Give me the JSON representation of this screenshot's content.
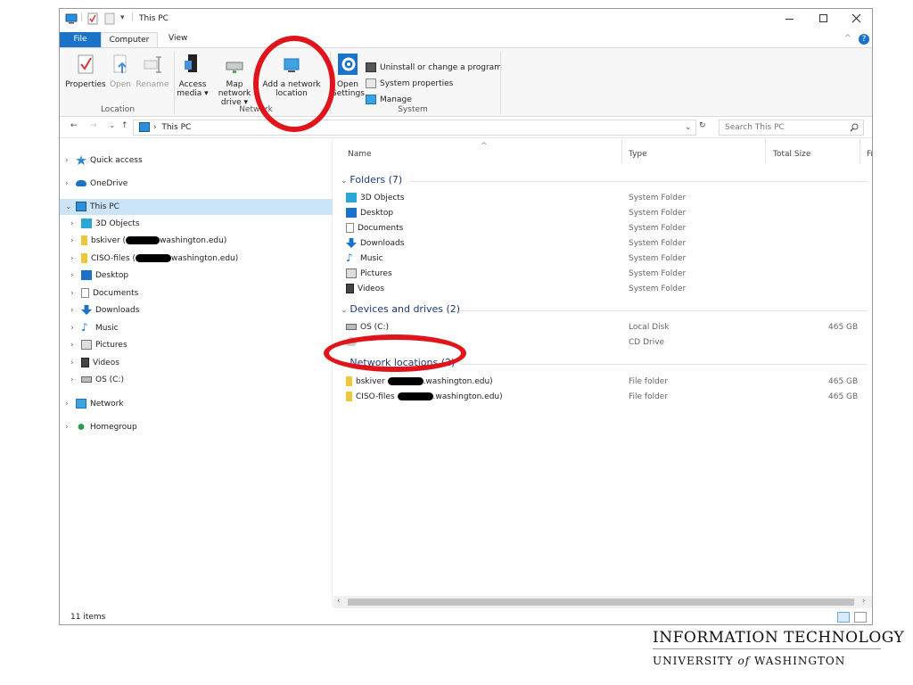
{
  "window": {
    "title": "This PC"
  },
  "ribbon": {
    "tabs": {
      "file": "File",
      "computer": "Computer",
      "view": "View"
    },
    "location": {
      "label": "Location",
      "properties": "Properties",
      "open": "Open",
      "rename": "Rename"
    },
    "network": {
      "label": "Network",
      "access_media_1": "Access",
      "access_media_2": "media ▾",
      "map_drive_1": "Map network",
      "map_drive_2": "drive ▾",
      "add_location_1": "Add a network",
      "add_location_2": "location"
    },
    "system": {
      "label": "System",
      "open_settings_1": "Open",
      "open_settings_2": "Settings",
      "uninstall": "Uninstall or change a program",
      "system_properties": "System properties",
      "manage": "Manage"
    }
  },
  "address": {
    "path": "This PC",
    "search_placeholder": "Search This PC"
  },
  "navpane": {
    "quick_access": "Quick access",
    "onedrive": "OneDrive",
    "this_pc": "This PC",
    "objects3d": "3D Objects",
    "bskiver_prefix": "bskiver (",
    "bskiver_suffix": "washington.edu)",
    "ciso_prefix": "CISO-files (",
    "ciso_suffix": "washington.edu)",
    "desktop": "Desktop",
    "documents": "Documents",
    "downloads": "Downloads",
    "music": "Music",
    "pictures": "Pictures",
    "videos": "Videos",
    "osc": "OS (C:)",
    "network": "Network",
    "homegroup": "Homegroup"
  },
  "columns": {
    "name": "Name",
    "type": "Type",
    "total_size": "Total Size",
    "free": "Fr"
  },
  "groups": {
    "folders": "Folders (7)",
    "devices": "Devices and drives (2)",
    "network": "Network locations (2)"
  },
  "folders": [
    {
      "name": "3D Objects",
      "type": "System Folder"
    },
    {
      "name": "Desktop",
      "type": "System Folder"
    },
    {
      "name": "Documents",
      "type": "System Folder"
    },
    {
      "name": "Downloads",
      "type": "System Folder"
    },
    {
      "name": "Music",
      "type": "System Folder"
    },
    {
      "name": "Pictures",
      "type": "System Folder"
    },
    {
      "name": "Videos",
      "type": "System Folder"
    }
  ],
  "drives": [
    {
      "name": "OS (C:)",
      "type": "Local Disk",
      "size": "465 GB"
    },
    {
      "name": "",
      "type": "CD Drive",
      "size": ""
    }
  ],
  "netlocs": [
    {
      "prefix": "bskiver",
      "suffix": ".washington.edu)",
      "type": "File folder",
      "size": "465 GB"
    },
    {
      "prefix": "CISO-files",
      "suffix": ".washington.edu)",
      "type": "File folder",
      "size": "465 GB"
    }
  ],
  "status": {
    "items": "11 items"
  },
  "branding": {
    "line1": "INFORMATION TECHNOLOGY",
    "line2_a": "UNIVERSITY ",
    "line2_of": "of",
    "line2_b": " WASHINGTON"
  },
  "colors": {
    "accent": "#1a73c9",
    "highlight": "#e0141a",
    "selection": "#cce4f7"
  }
}
